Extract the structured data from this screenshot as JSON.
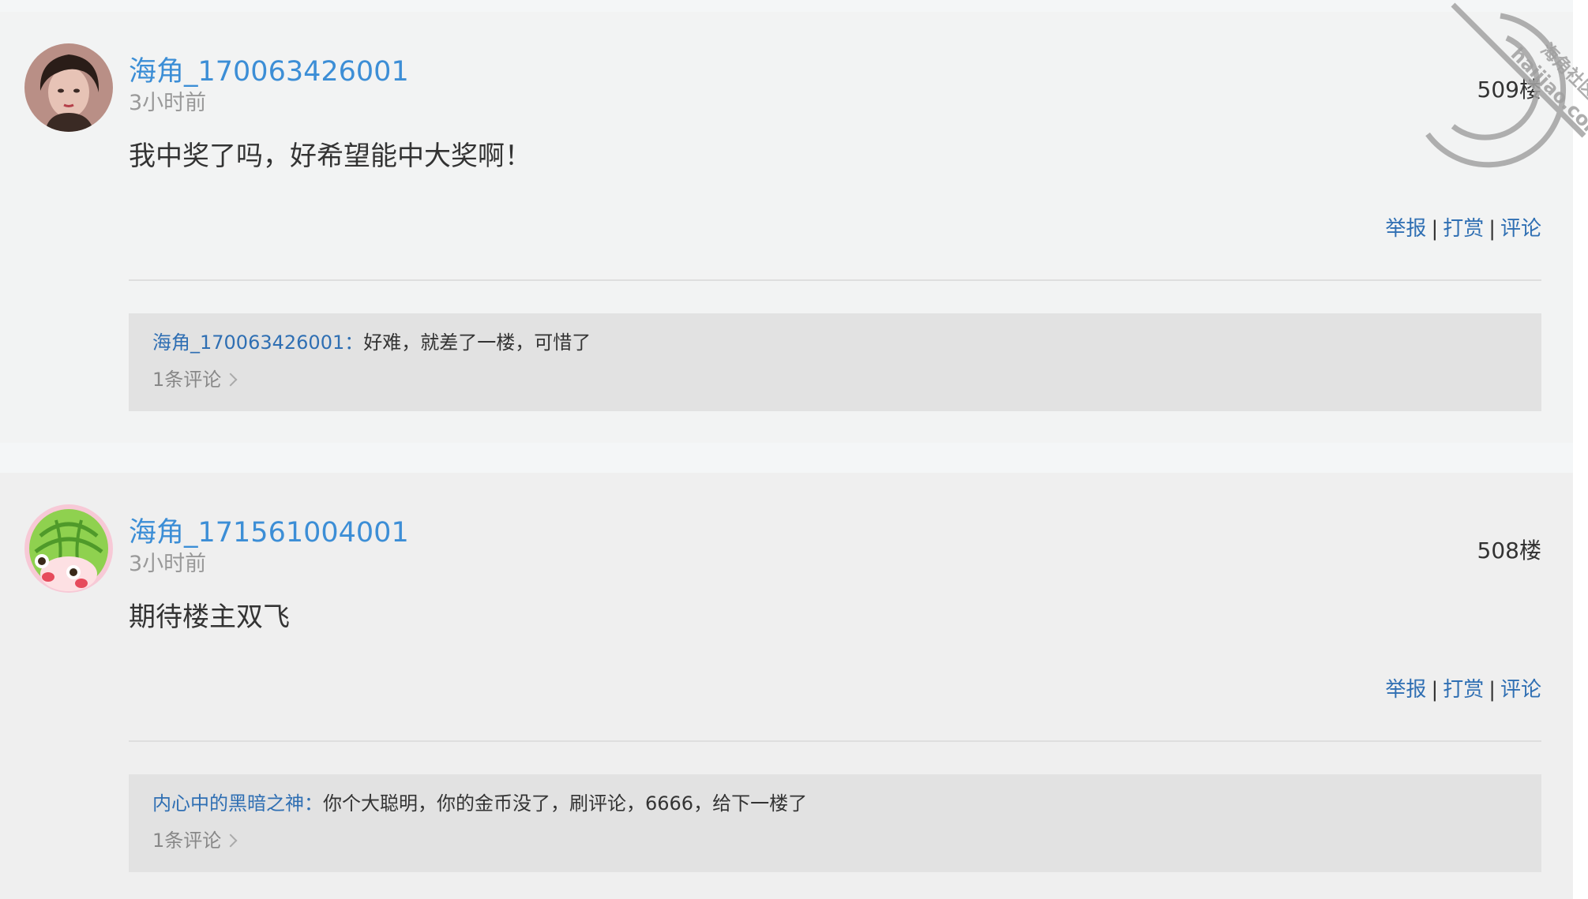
{
  "posts": [
    {
      "username": "海角_170063426001",
      "time": "3小时前",
      "floor": "509楼",
      "content": "我中奖了吗，好希望能中大奖啊！",
      "actions": {
        "report": "举报",
        "tip": "打赏",
        "comment": "评论",
        "separator": "|"
      },
      "reply": {
        "author": "海角_170063426001",
        "colon": "：",
        "text": "好难，就差了一楼，可惜了",
        "count": "1条评论"
      }
    },
    {
      "username": "海角_171561004001",
      "time": "3小时前",
      "floor": "508楼",
      "content": "期待楼主双飞",
      "actions": {
        "report": "举报",
        "tip": "打赏",
        "comment": "评论",
        "separator": "|"
      },
      "reply": {
        "author": "内心中的黑暗之神",
        "colon": "：",
        "text": "你个大聪明，你的金币没了，刷评论，6666，给下一楼了",
        "count": "1条评论"
      }
    }
  ],
  "watermark": {
    "line1": "海角社区",
    "line2": "haijiao.com",
    "color": "#9a9a9a"
  },
  "colors": {
    "username": "#3c8ed6",
    "link": "#2f6fb3",
    "muted": "#999999",
    "text": "#333333"
  }
}
